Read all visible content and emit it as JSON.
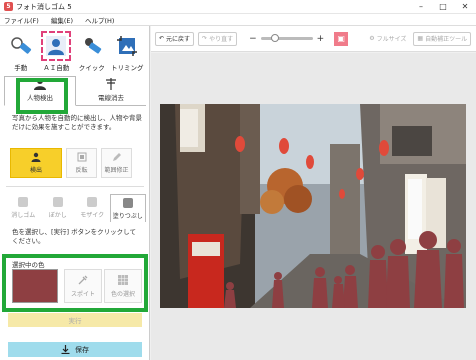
{
  "window": {
    "title": "フォト消しゴム 5",
    "icon_char": "5"
  },
  "menu": [
    "ファイル(F)",
    "編集(E)",
    "ヘルプ(H)"
  ],
  "tools": [
    {
      "label": "手動",
      "icon": "brush-icon"
    },
    {
      "label": "ＡＩ自動",
      "icon": "ai-person-icon"
    },
    {
      "label": "クイック",
      "icon": "quick-brush-icon"
    },
    {
      "label": "トリミング",
      "icon": "crop-icon"
    }
  ],
  "tabs": [
    {
      "label": "人物検出",
      "icon": "person-icon"
    },
    {
      "label": "電線消去",
      "icon": "power-line-icon"
    }
  ],
  "description1": "写真から人物を自動的に検出し、人物や背景だけに効果を施すことができます。",
  "mode_buttons": [
    {
      "label": "検出",
      "icon": "person-detect-icon"
    },
    {
      "label": "反転",
      "icon": "invert-icon"
    },
    {
      "label": "範囲修正",
      "icon": "pencil-icon"
    }
  ],
  "subtools": [
    "消しゴム",
    "ぼかし",
    "モザイク",
    "塗りつぶし"
  ],
  "description2": "色を選択し、[実行] ボタンをクリックしてください。",
  "color_section": {
    "label": "選択中の色",
    "swatch_color": "#8e3f42",
    "eyedropper_label": "スポイト",
    "picker_label": "色の選択"
  },
  "run_label": "実行",
  "save_label": "保存",
  "toolbar": {
    "undo_label": "元に戻す",
    "redo_label": "やり直す",
    "fullsize_label": "フルサイズ",
    "fit_label": "自動補正ツール",
    "zoom_minus": "−",
    "zoom_plus": "+"
  },
  "highlight_color": "#22a838"
}
